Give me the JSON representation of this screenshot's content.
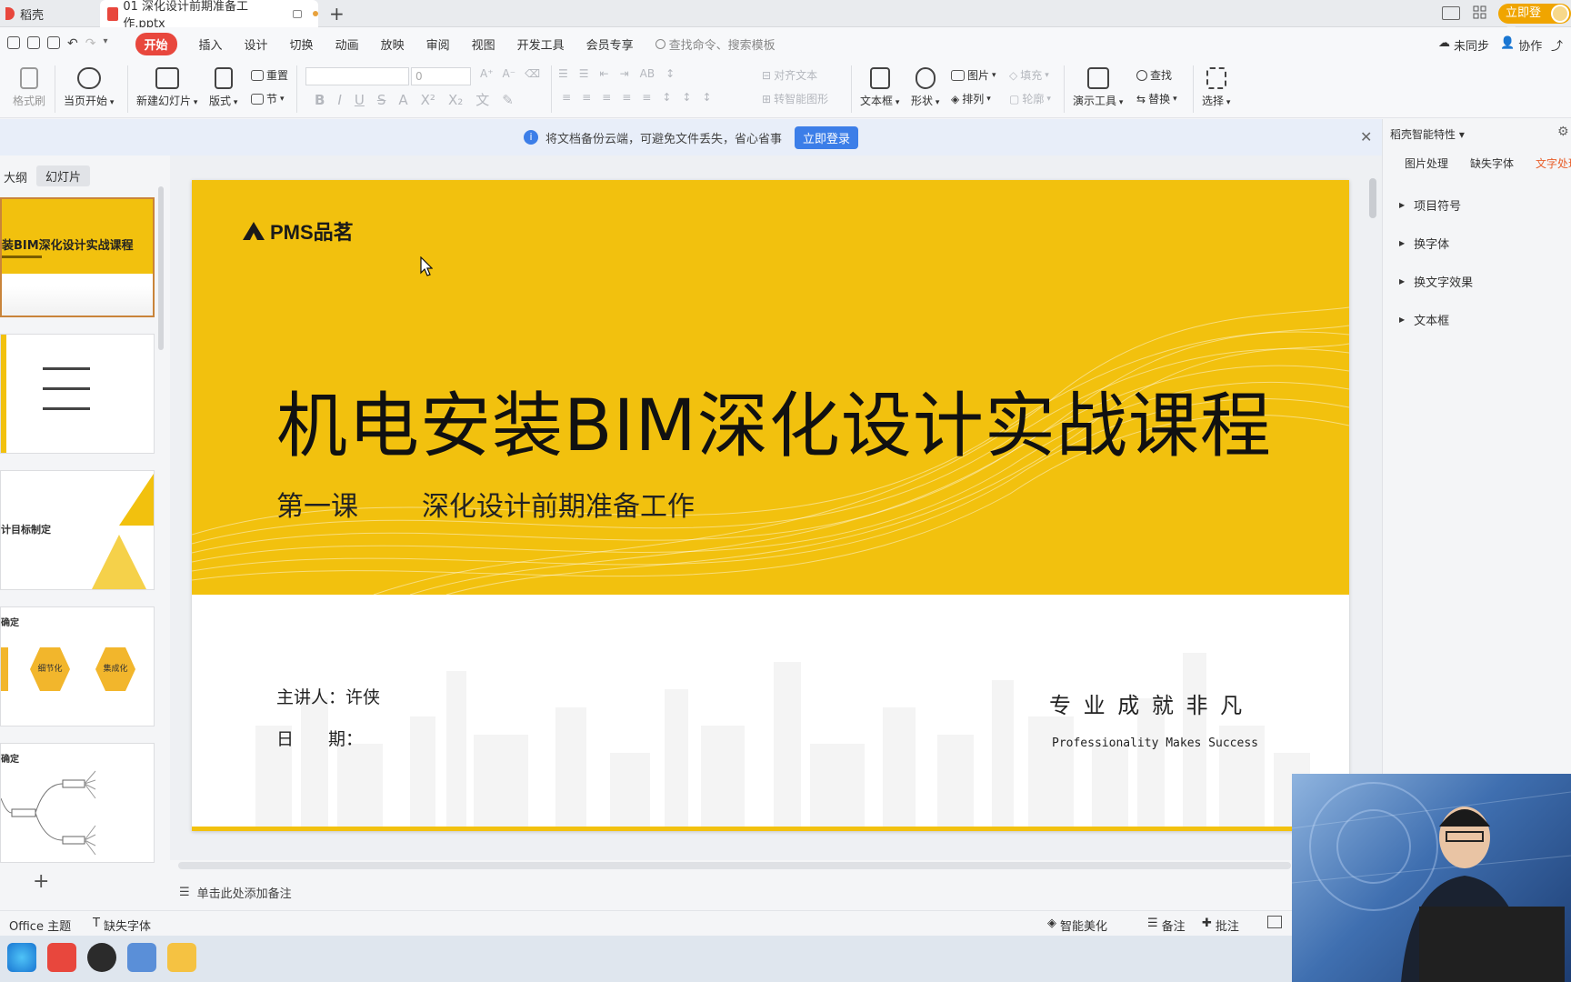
{
  "titlebar": {
    "tab_home": "稻壳",
    "tab_file": "01 深化设计前期准备工作.pptx",
    "new_tab": "+",
    "login_button": "立即登录"
  },
  "menubar": {
    "items": [
      "开始",
      "插入",
      "设计",
      "切换",
      "动画",
      "放映",
      "审阅",
      "视图",
      "开发工具",
      "会员专享"
    ],
    "search_placeholder": "查找命令、搜索模板",
    "sync": "未同步",
    "collab": "协作"
  },
  "ribbon": {
    "format_painter": "格式刷",
    "play_current": "当页开始",
    "new_slide": "新建幻灯片",
    "layout": "版式",
    "reset": "重置",
    "section": "节",
    "font_size": "0",
    "align_text": "对齐文本",
    "smart_shape": "转智能图形",
    "textbox": "文本框",
    "shape": "形状",
    "picture": "图片",
    "arrange": "排列",
    "fill": "填充",
    "outline": "轮廓",
    "presenter_tools": "演示工具",
    "find": "查找",
    "replace": "替换",
    "select": "选择"
  },
  "notice": {
    "text": "将文档备份云端，可避免文件丢失，省心省事",
    "button": "立即登录"
  },
  "left_panel": {
    "tab_outline": "大纲",
    "tab_slides": "幻灯片",
    "thumb1_title": "装BIM深化设计实战课程",
    "thumb3_title": "计目标制定",
    "thumb4_title": "确定",
    "thumb4_hex1": "细节化",
    "thumb4_hex2": "集成化",
    "thumb5_title": "确定",
    "add_slide": "+"
  },
  "slide": {
    "logo": "PMS品茗",
    "title": "机电安装BIM深化设计实战课程",
    "lesson": "第一课",
    "subtitle": "深化设计前期准备工作",
    "presenter": "主讲人：许侠",
    "date_label": "日　　期：",
    "slogan_cn": "专 业 成 就 非 凡",
    "slogan_en": "Professionality Makes Success"
  },
  "notes": {
    "placeholder": "单击此处添加备注"
  },
  "right_panel": {
    "header": "稻壳智能特性",
    "tabs": [
      "图片处理",
      "缺失字体",
      "文字处理"
    ],
    "items": [
      "项目符号",
      "换字体",
      "换文字效果",
      "文本框"
    ]
  },
  "statusbar": {
    "theme": "Office 主题",
    "missing_font": "缺失字体",
    "smart_beautify": "智能美化",
    "notes": "备注",
    "comments": "批注"
  },
  "colors": {
    "slide_yellow": "#f2c10e",
    "accent_red": "#e8473d",
    "accent_blue": "#3c7ee8",
    "login_orange": "#f0a500"
  }
}
